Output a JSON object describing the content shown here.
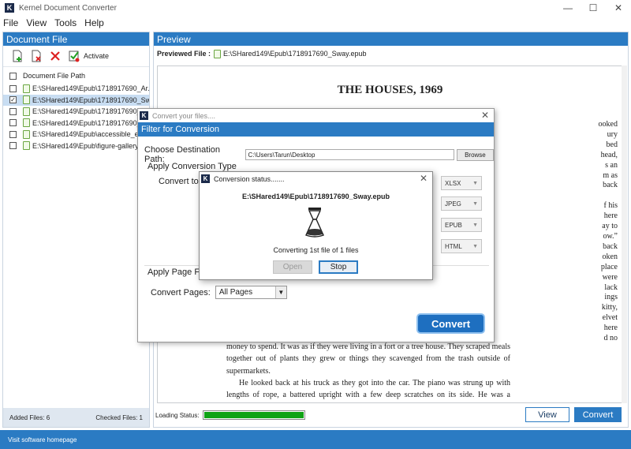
{
  "app": {
    "title": "Kernel Document Converter",
    "logo": "K"
  },
  "window_controls": {
    "minimize": "—",
    "maximize": "☐",
    "close": "✕"
  },
  "menu": [
    "File",
    "View",
    "Tools",
    "Help"
  ],
  "left_panel": {
    "header": "Document File",
    "activate_label": "Activate",
    "column_header": "Document File Path",
    "files": [
      {
        "path": "E:\\SHared149\\Epub\\1718917690_Ar...",
        "checked": false,
        "selected": false
      },
      {
        "path": "E:\\SHared149\\Epub\\1718917690_Sw...",
        "checked": true,
        "selected": true
      },
      {
        "path": "E:\\SHared149\\Epub\\1718917690_fa",
        "checked": false,
        "selected": false
      },
      {
        "path": "E:\\SHared149\\Epub\\1718917690_Si",
        "checked": false,
        "selected": false
      },
      {
        "path": "E:\\SHared149\\Epub\\accessible_epu",
        "checked": false,
        "selected": false
      },
      {
        "path": "E:\\SHared149\\Epub\\figure-gallery-b",
        "checked": false,
        "selected": false
      }
    ],
    "added_files": "Added Files: 6",
    "checked_files": "Checked Files: 1"
  },
  "preview": {
    "header": "Preview",
    "file_label": "Previewed File :",
    "file_path": "E:\\SHared149\\Epub\\1718917690_Sway.epub",
    "doc_title": "THE HOUSES, 1969",
    "edge_words": [
      "ooked",
      "ury",
      "bed",
      "head,",
      "s an",
      "m as",
      "back",
      "",
      "f his",
      "here",
      "ay to",
      "ow.”",
      "back",
      "oken",
      "place",
      "were",
      "lack",
      "ings",
      "kitty,",
      "elvet",
      "here",
      "d no"
    ],
    "paragraphs": [
      "money to spend. It was as if they were living in a fort or a tree house. They scraped meals together out of plants they grew or things they scavenged from the trash outside of supermarkets.",
      "He looked back at his truck as they got into the car. The piano was strung up with lengths of rope, a battered upright with a few deep scratches on its side. He was a musician — that had been his plat, to be a rock musician — but it struck him"
    ],
    "loading_label": "Loading Status:",
    "loading_progress": 1.0,
    "view_button": "View",
    "convert_button": "Convert"
  },
  "bottom_status": "Visit software homepage",
  "convert_dialog": {
    "title": "Convert your files....",
    "band": "Filter for Conversion",
    "dest_label": "Choose Destination Path:",
    "dest_path": "C:\\Users\\Tarun\\Desktop",
    "browse": "Browse",
    "apply_type": "Apply Conversion Type",
    "convert_to": "Convert to:",
    "formats": [
      "XLSX",
      "JPEG",
      "EPUB",
      "HTML"
    ],
    "apply_page": "Apply Page Filt",
    "convert_pages_label": "Convert Pages:",
    "convert_pages_value": "All Pages",
    "convert_button": "Convert",
    "close": "✕"
  },
  "status_dialog": {
    "title": "Conversion status.......",
    "file": "E:\\SHared149\\Epub\\1718917690_Sway.epub",
    "message": "Converting 1st file of 1 files",
    "open": "Open",
    "stop": "Stop",
    "close": "✕"
  }
}
